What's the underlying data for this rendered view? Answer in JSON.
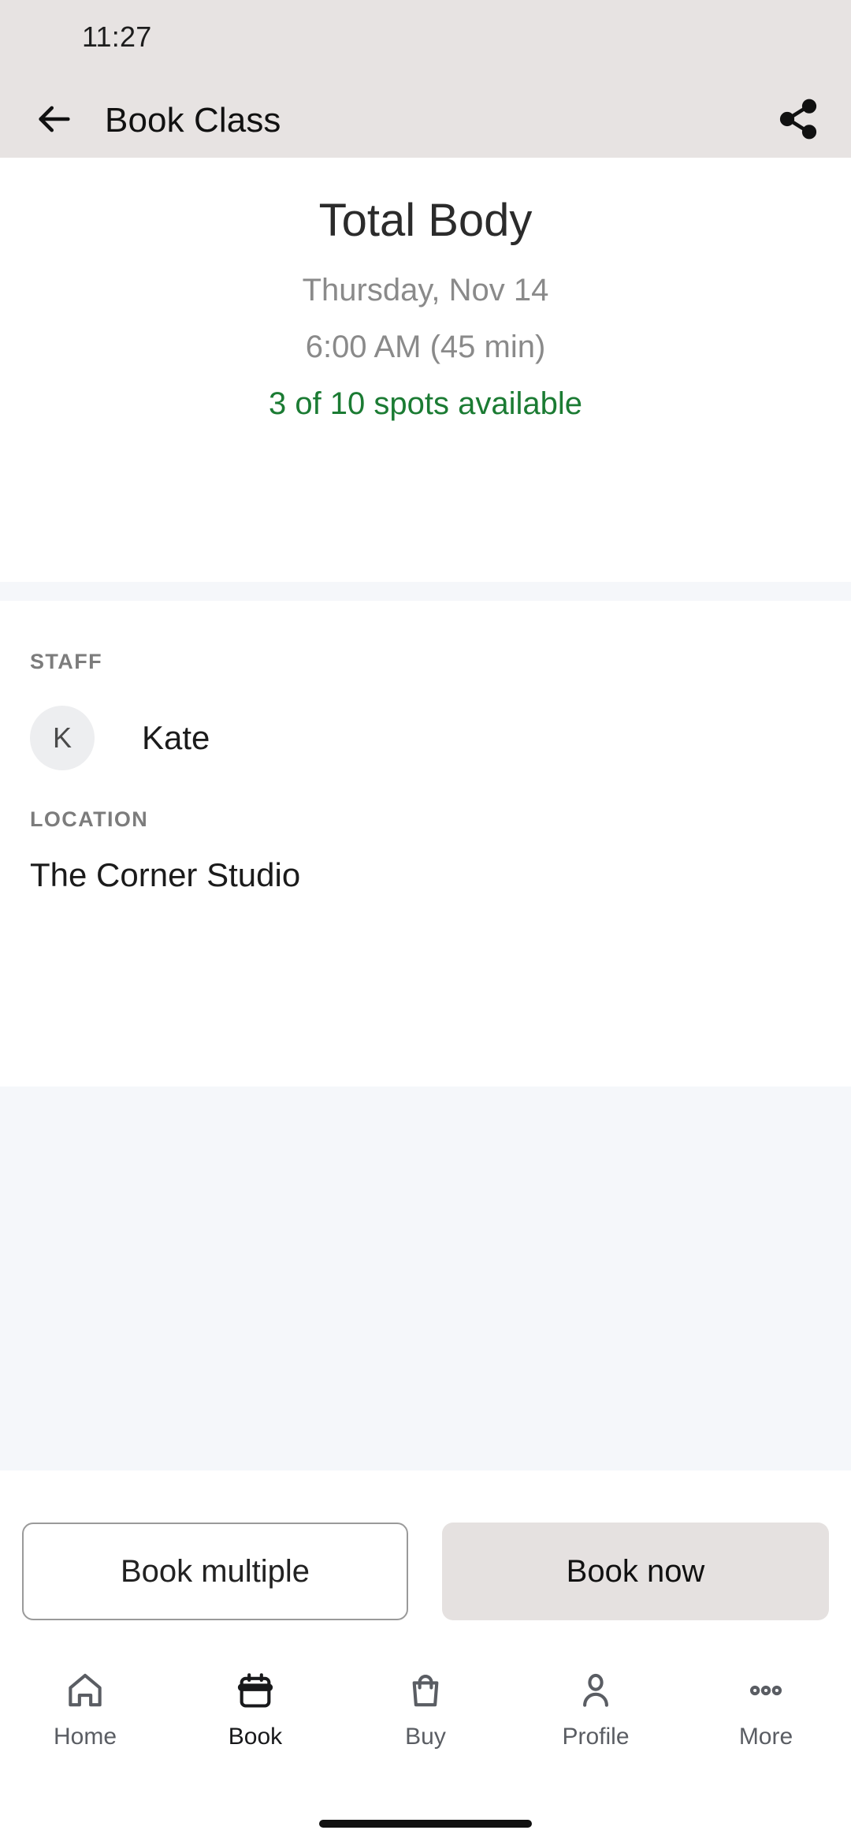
{
  "status_bar": {
    "time": "11:27"
  },
  "app_bar": {
    "back_icon": "arrow-left-icon",
    "title": "Book Class",
    "share_icon": "share-icon"
  },
  "class": {
    "name": "Total Body",
    "date": "Thursday, Nov 14",
    "time": "6:00 AM (45 min)",
    "spots": "3 of 10 spots available",
    "spots_color": "#1B7B33"
  },
  "details": {
    "staff_label": "STAFF",
    "staff_initial": "K",
    "staff_name": "Kate",
    "location_label": "LOCATION",
    "location_name": "The Corner Studio"
  },
  "actions": {
    "secondary_label": "Book multiple",
    "primary_label": "Book now",
    "primary_bg": "#E5E1E0"
  },
  "bottom_nav": {
    "items": [
      {
        "label": "Home",
        "icon": "home-icon",
        "active": false
      },
      {
        "label": "Book",
        "icon": "calendar-icon",
        "active": true
      },
      {
        "label": "Buy",
        "icon": "shopping-bag-icon",
        "active": false
      },
      {
        "label": "Profile",
        "icon": "person-icon",
        "active": false
      },
      {
        "label": "More",
        "icon": "ellipsis-icon",
        "active": false
      }
    ]
  }
}
